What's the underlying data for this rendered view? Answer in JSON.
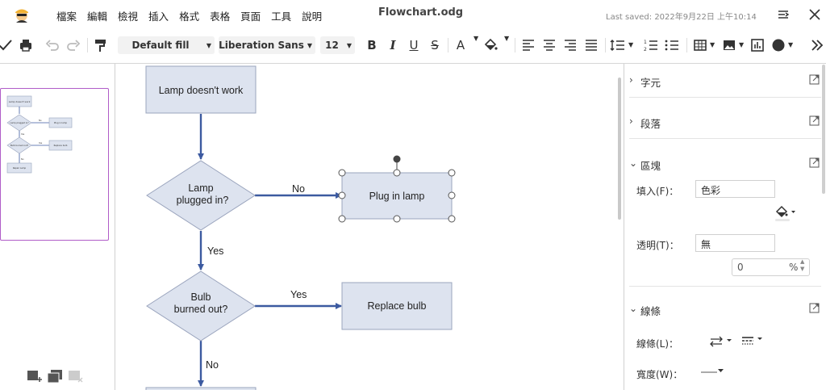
{
  "menu": [
    "檔案",
    "編輯",
    "檢視",
    "插入",
    "格式",
    "表格",
    "頁面",
    "工具",
    "說明"
  ],
  "doc_title": "Flowchart.odg",
  "last_saved": "Last saved: 2022年9月22日 上午10:14",
  "toolbar": {
    "fill_style": "Default fill",
    "font_name": "Liberation Sans",
    "font_size": "12",
    "bold": "B",
    "italic": "I",
    "underline": "U",
    "strike": "S",
    "font_color": "A"
  },
  "flowchart": {
    "box_lamp": "Lamp doesn't work",
    "diamond_plugged_l1": "Lamp",
    "diamond_plugged_l2": "plugged in?",
    "label_no_1": "No",
    "box_plug": "Plug in lamp",
    "label_yes_1": "Yes",
    "diamond_bulb_l1": "Bulb",
    "diamond_bulb_l2": "burned out?",
    "label_yes_2": "Yes",
    "box_replace": "Replace bulb",
    "label_no_2": "No"
  },
  "thumbnail": {
    "t1": "Lamp doesn't work",
    "t2": "Lamp plugged in?",
    "t3": "Plug in lamp",
    "t4": "Bulb burned out?",
    "t5": "Replace bulb",
    "t6": "Repair Lamp",
    "t_no": "No",
    "t_yes": "Yes"
  },
  "sidebar": {
    "sec_character": "字元",
    "sec_paragraph": "段落",
    "sec_area": "區塊",
    "fill_label": "填入(F)：",
    "fill_value": "色彩",
    "transparency_label": "透明(T)：",
    "transparency_value": "無",
    "percent_value": "0",
    "percent_unit": "%",
    "sec_line": "線條",
    "line_label": "線條(L)：",
    "width_label": "寬度(W)："
  },
  "colors": {
    "accent": "#b05cc8",
    "shape_fill": "#dde3ef",
    "shape_border": "#9aa4bd",
    "connector": "#3c5aa0"
  }
}
